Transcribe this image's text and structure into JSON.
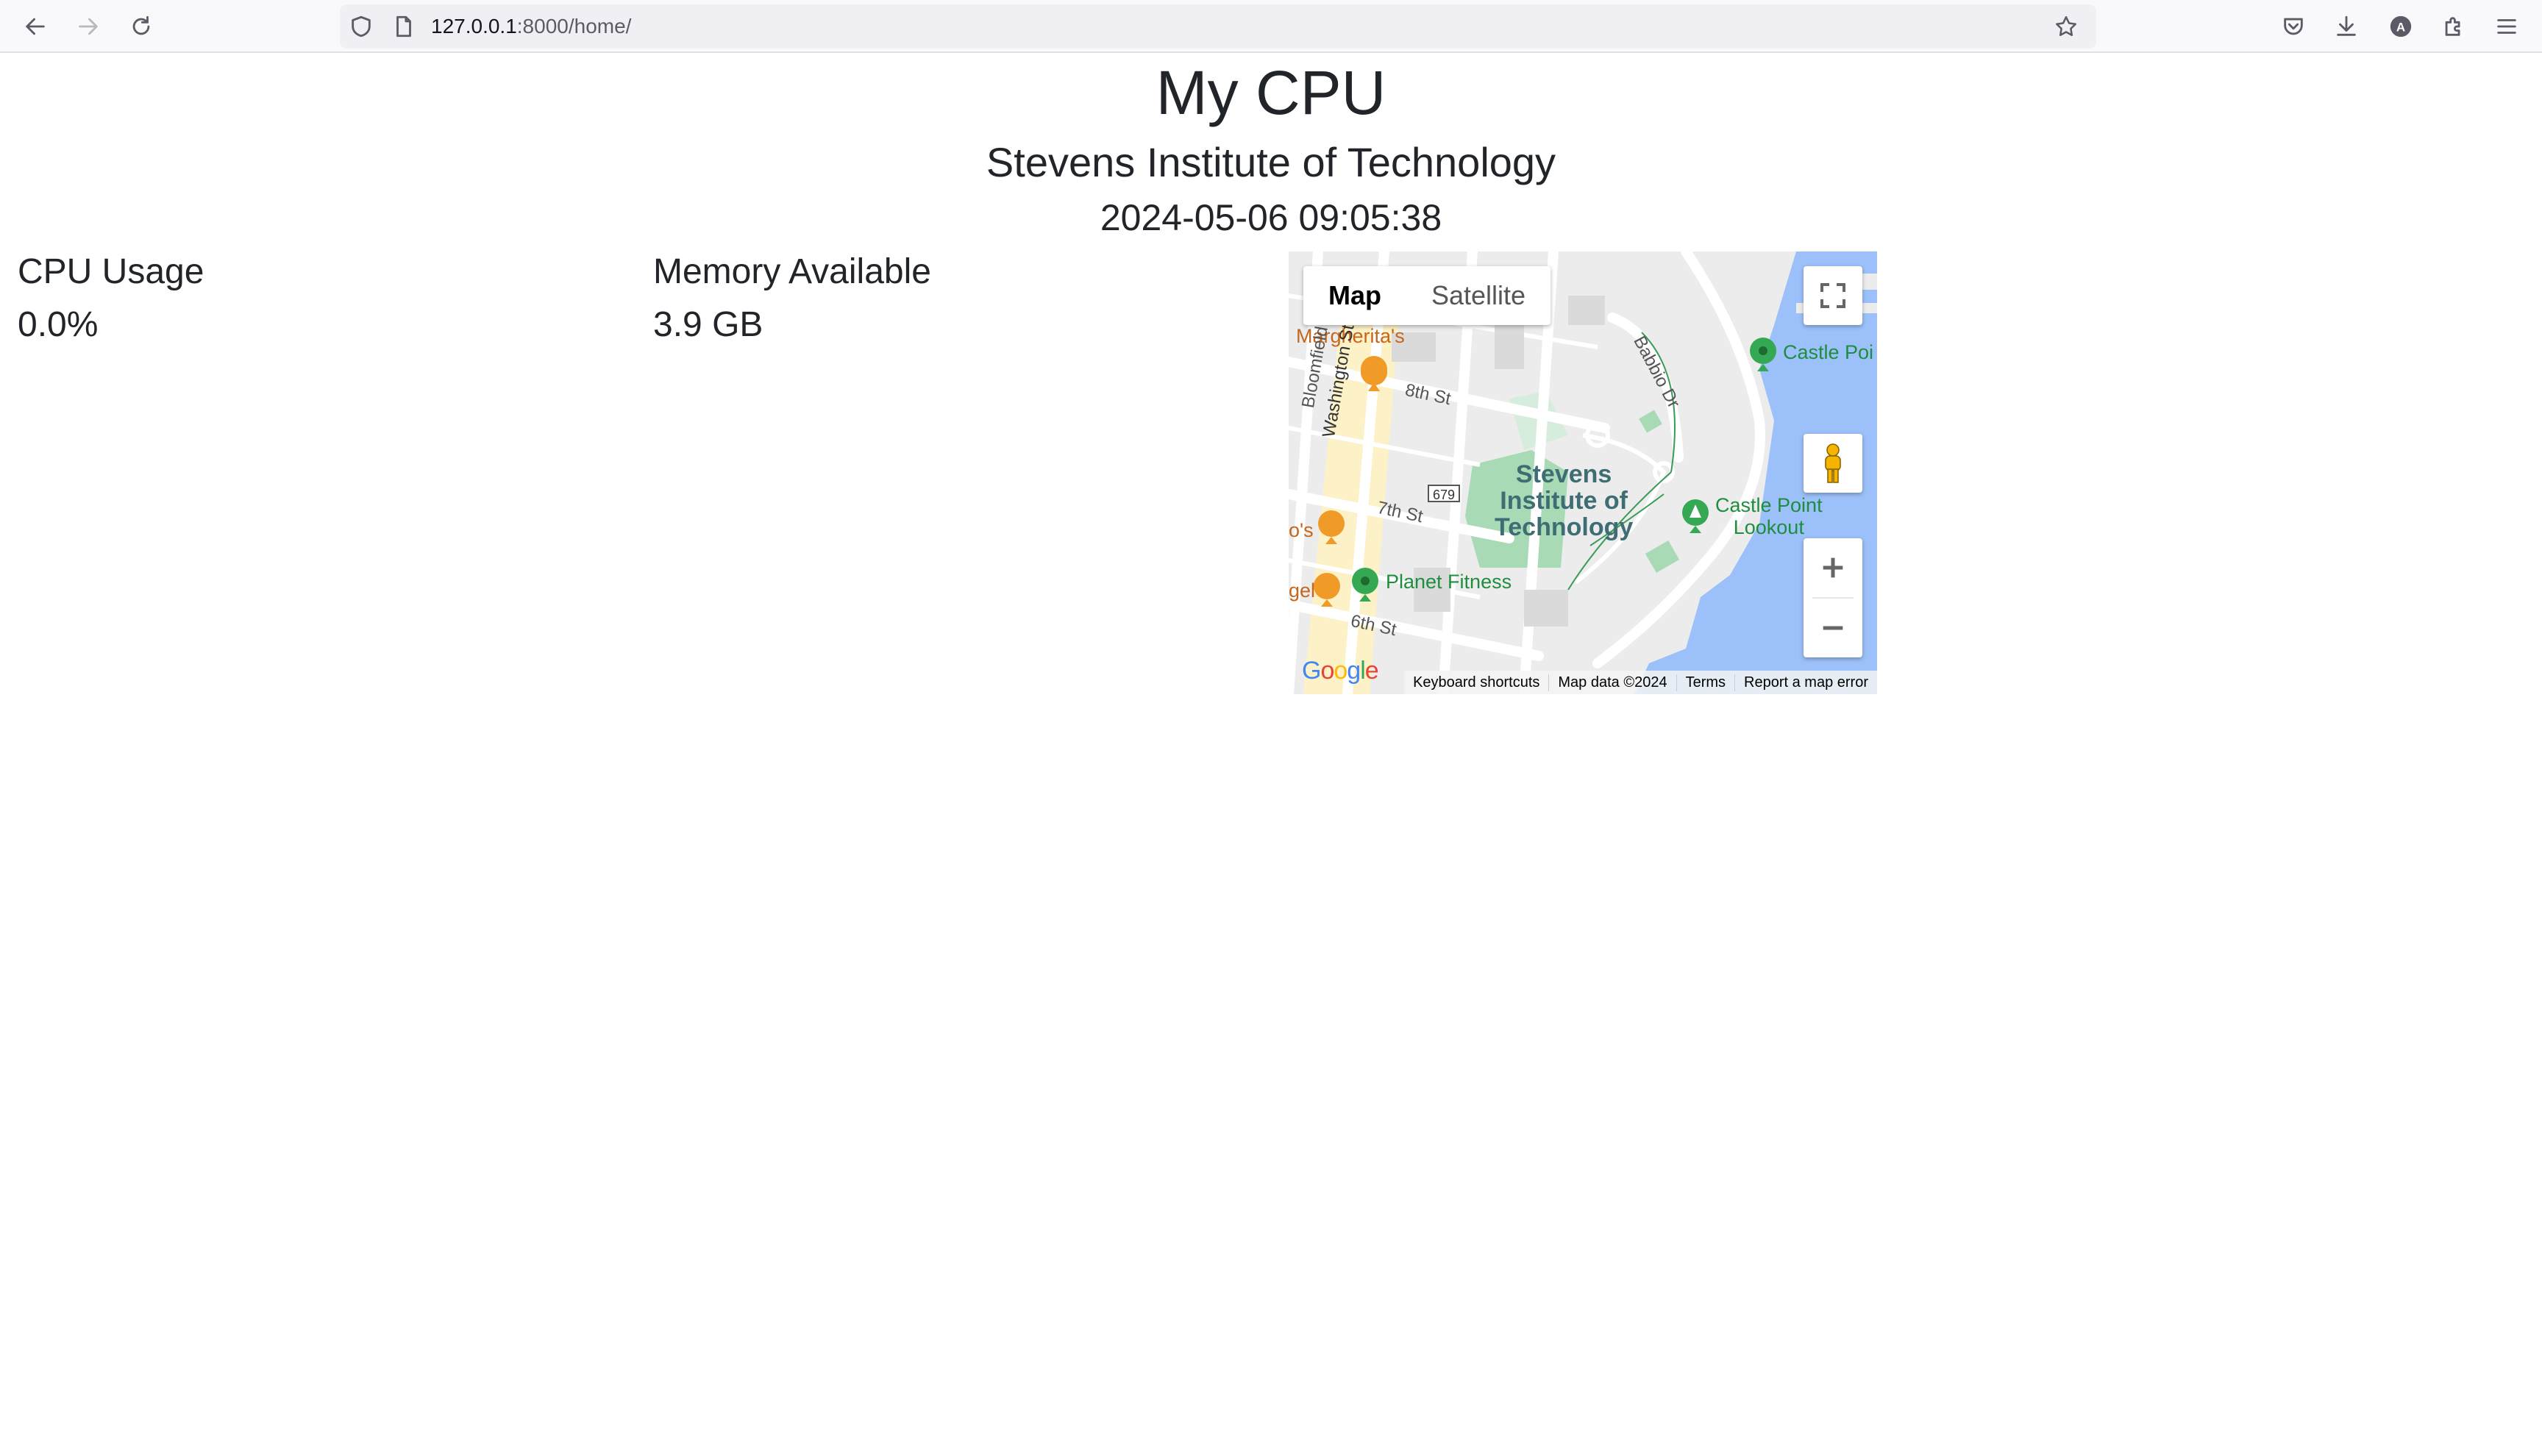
{
  "browser": {
    "url_host": "127.0.0.1",
    "url_rest": ":8000/home/"
  },
  "page": {
    "title": "My CPU",
    "subtitle": "Stevens Institute of Technology",
    "timestamp": "2024-05-06 09:05:38"
  },
  "stats": {
    "cpu_label": "CPU Usage",
    "cpu_value": "0.0%",
    "memory_label": "Memory Available",
    "memory_value": "3.9 GB"
  },
  "map": {
    "type_map": "Map",
    "type_satellite": "Satellite",
    "google": "Google",
    "attribution": {
      "shortcuts": "Keyboard shortcuts",
      "data": "Map data ©2024",
      "terms": "Terms",
      "report": "Report a map error"
    },
    "places": {
      "margherita": "Margherita's",
      "castle_point": "Castle Poi",
      "stevens_l1": "Stevens",
      "stevens_l2": "Institute of",
      "stevens_l3": "Technology",
      "lookout_l1": "Castle Point",
      "lookout_l2": "Lookout",
      "planet_fitness": "Planet Fitness",
      "os": "o's",
      "gel": "gel"
    },
    "streets": {
      "eighth": "8th St",
      "seventh": "7th St",
      "sixth": "6th St",
      "washington": "Washington St",
      "bloomfield": "Bloomfield St",
      "babbio": "Babbio Dr",
      "route": "679"
    }
  }
}
